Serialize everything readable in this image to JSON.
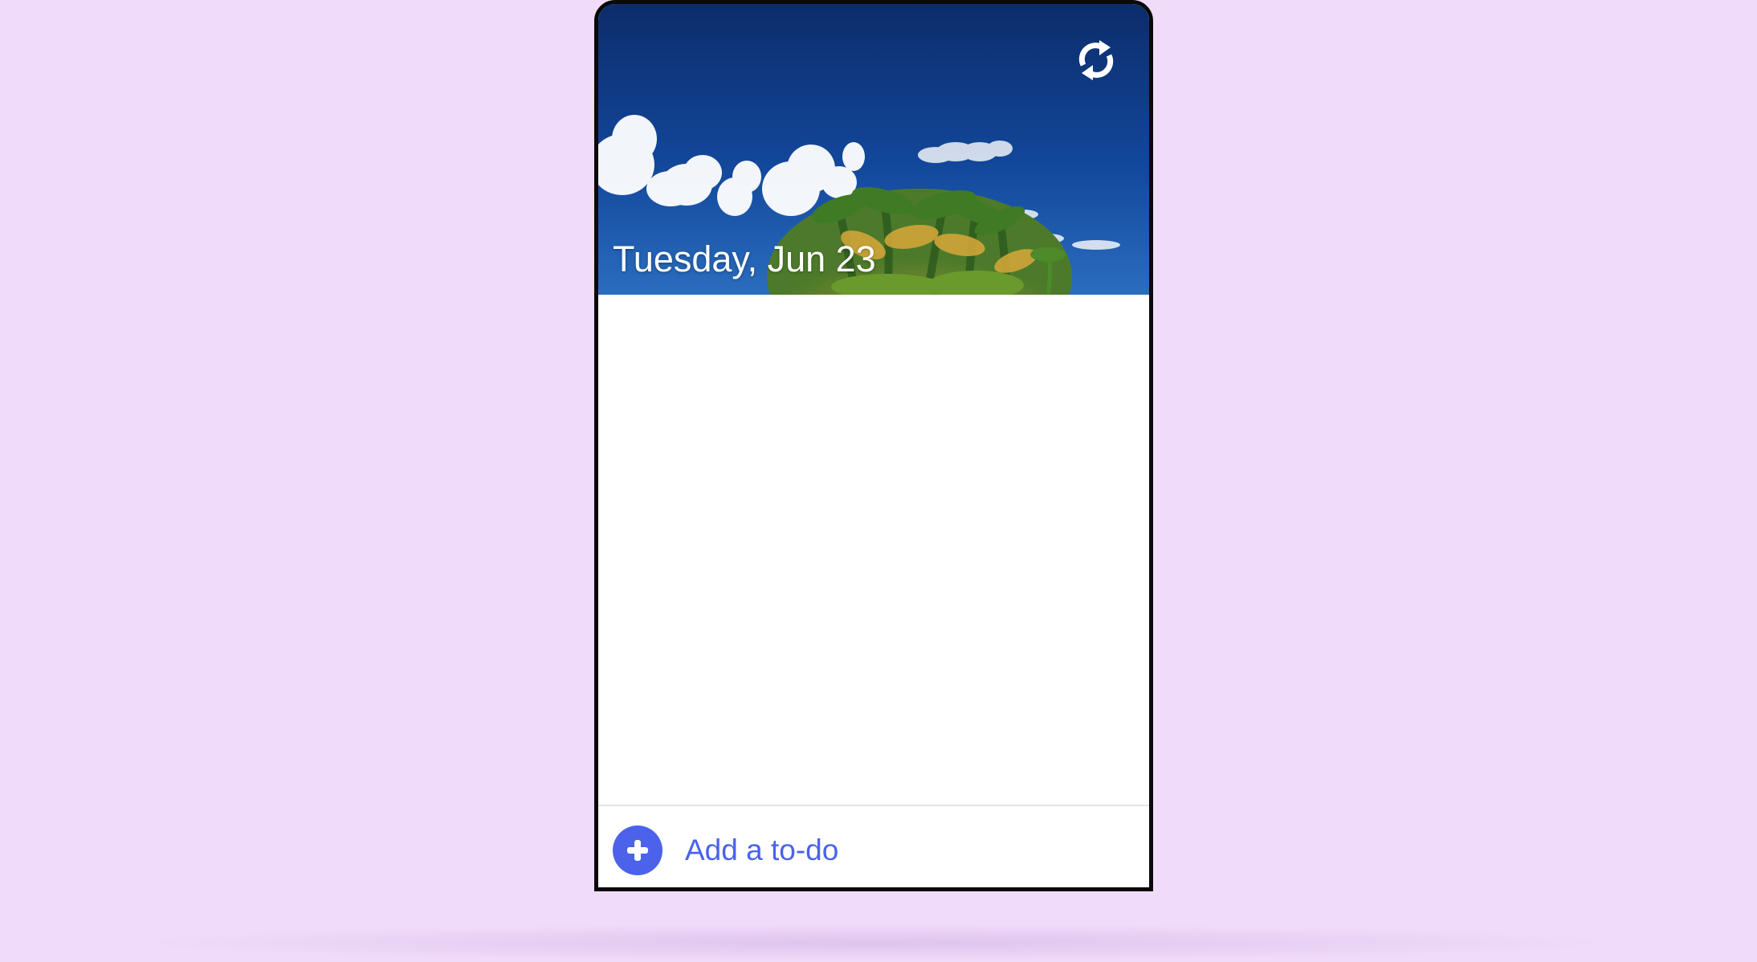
{
  "app": {
    "header": {
      "date_title": "Tuesday, Jun 23",
      "refresh_icon": "refresh-icon"
    },
    "footer": {
      "add_label": "Add a to-do",
      "add_icon": "plus-circle-icon"
    },
    "todos": []
  },
  "colors": {
    "page_background": "#f0dcfa",
    "accent": "#4a63ea",
    "sky_top": "#0d2f6e",
    "sky_bottom": "#1a5aa8"
  }
}
